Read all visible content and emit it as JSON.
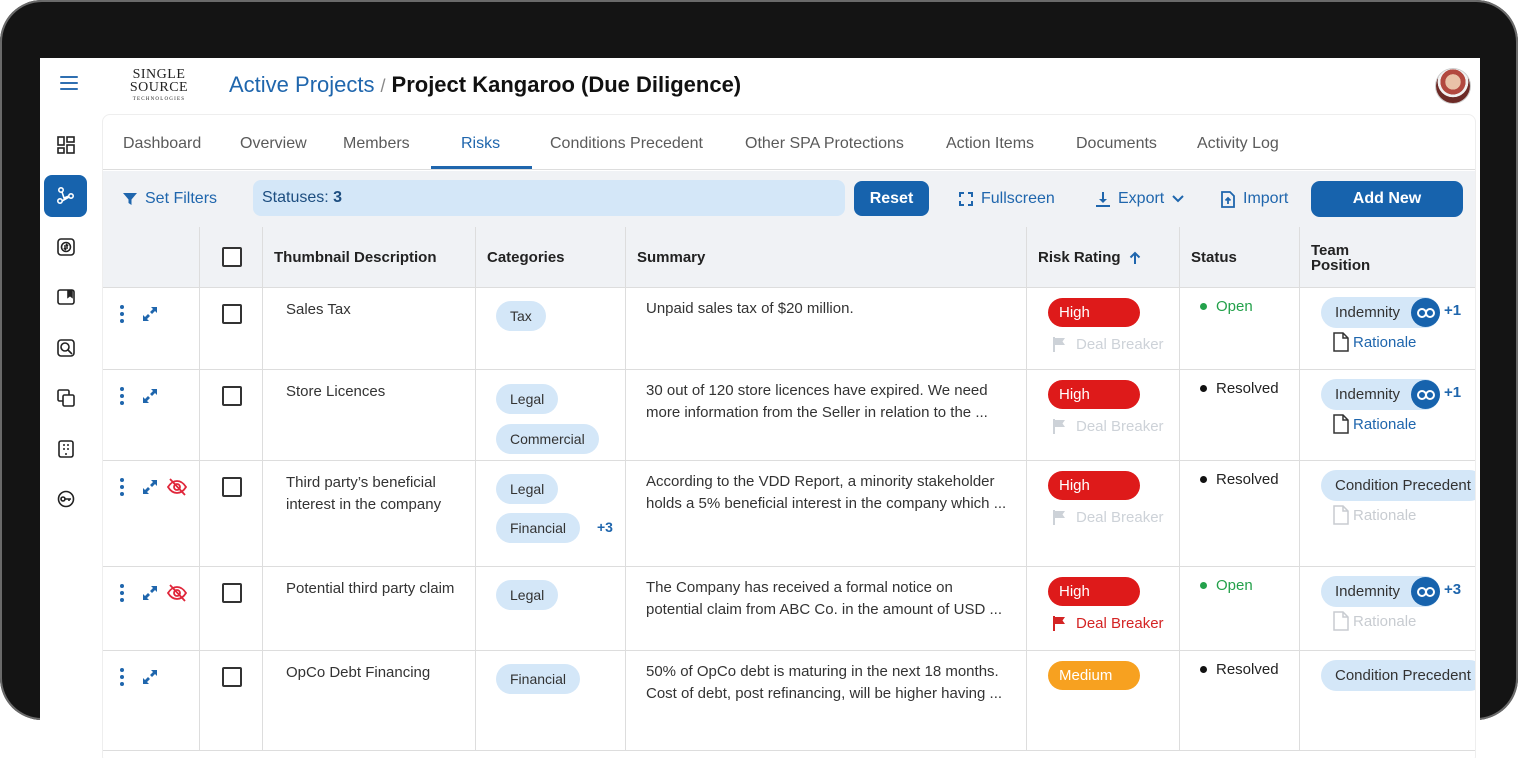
{
  "header": {
    "logo": {
      "line1": "SINGLE",
      "line2": "SOURCE",
      "line3": "TECHNOLOGIES"
    },
    "breadcrumb_parent": "Active Projects",
    "breadcrumb_separator": "/",
    "page_title": "Project Kangaroo (Due Diligence)"
  },
  "sidebar": {
    "items": [
      {
        "icon": "dashboard-grid-icon",
        "active": false
      },
      {
        "icon": "network-share-icon",
        "active": true
      },
      {
        "icon": "exchange-box-icon",
        "active": false
      },
      {
        "icon": "card-clip-icon",
        "active": false
      },
      {
        "icon": "search-box-icon",
        "active": false
      },
      {
        "icon": "copy-stack-icon",
        "active": false
      },
      {
        "icon": "building-icon",
        "active": false
      },
      {
        "icon": "key-icon",
        "active": false
      }
    ]
  },
  "tabs": [
    "Dashboard",
    "Overview",
    "Members",
    "Risks",
    "Conditions Precedent",
    "Other SPA Protections",
    "Action Items",
    "Documents",
    "Activity Log"
  ],
  "toolbar": {
    "set_filters": "Set Filters",
    "status_chip_label": "Statuses:",
    "status_chip_count": "3",
    "reset": "Reset",
    "fullscreen": "Fullscreen",
    "export": "Export",
    "import": "Import",
    "add_new": "Add New"
  },
  "table": {
    "columns": {
      "thumbnail": "Thumbnail Description",
      "categories": "Categories",
      "summary": "Summary",
      "risk_rating": "Risk Rating",
      "status": "Status",
      "team_line1": "Team",
      "team_line2": "Position"
    },
    "rows": [
      {
        "description": "Sales Tax",
        "categories": [
          "Tax"
        ],
        "more_categories": "",
        "summary": [
          "Unpaid sales tax of $20 million."
        ],
        "risk": "High",
        "deal_breaker": "Deal Breaker",
        "status": "Open",
        "team": "Indemnity",
        "team_more": "+1",
        "rationale": "Rationale"
      },
      {
        "description": "Store Licences",
        "categories": [
          "Legal",
          "Commercial"
        ],
        "more_categories": "",
        "summary": [
          "30 out of 120 store licences have expired. We need",
          "more information from the Seller in relation to the ..."
        ],
        "risk": "High",
        "deal_breaker": "Deal Breaker",
        "status": "Resolved",
        "team": "Indemnity",
        "team_more": "+1",
        "rationale": "Rationale"
      },
      {
        "description": "Third party’s beneficial interest in the company",
        "categories": [
          "Legal",
          "Financial"
        ],
        "more_categories": "+3",
        "summary": [
          "According to the VDD Report, a minority stakeholder",
          "holds a 5% beneficial interest in the company which ..."
        ],
        "risk": "High",
        "deal_breaker": "Deal Breaker",
        "status": "Resolved",
        "team": "Condition Precedent",
        "team_more": "",
        "rationale": "Rationale"
      },
      {
        "description": "Potential third party claim",
        "categories": [
          "Legal"
        ],
        "more_categories": "",
        "summary": [
          "The Company has received a formal notice on",
          "potential claim from ABC Co. in the amount of USD ..."
        ],
        "risk": "High",
        "deal_breaker": "Deal Breaker",
        "status": "Open",
        "team": "Indemnity",
        "team_more": "+3",
        "rationale": "Rationale"
      },
      {
        "description": "OpCo Debt Financing",
        "categories": [
          "Financial"
        ],
        "more_categories": "",
        "summary": [
          "50% of OpCo debt is maturing in the next 18 months.",
          "Cost of debt, post refinancing, will be higher having ..."
        ],
        "risk": "Medium",
        "deal_breaker": "",
        "status": "Resolved",
        "team": "Condition Precedent",
        "team_more": "",
        "rationale": ""
      }
    ]
  },
  "colors": {
    "primary": "#1763ad",
    "high": "#de1a1a",
    "medium": "#f7a120",
    "open": "#24a14b",
    "chip": "#d4e7f8"
  }
}
